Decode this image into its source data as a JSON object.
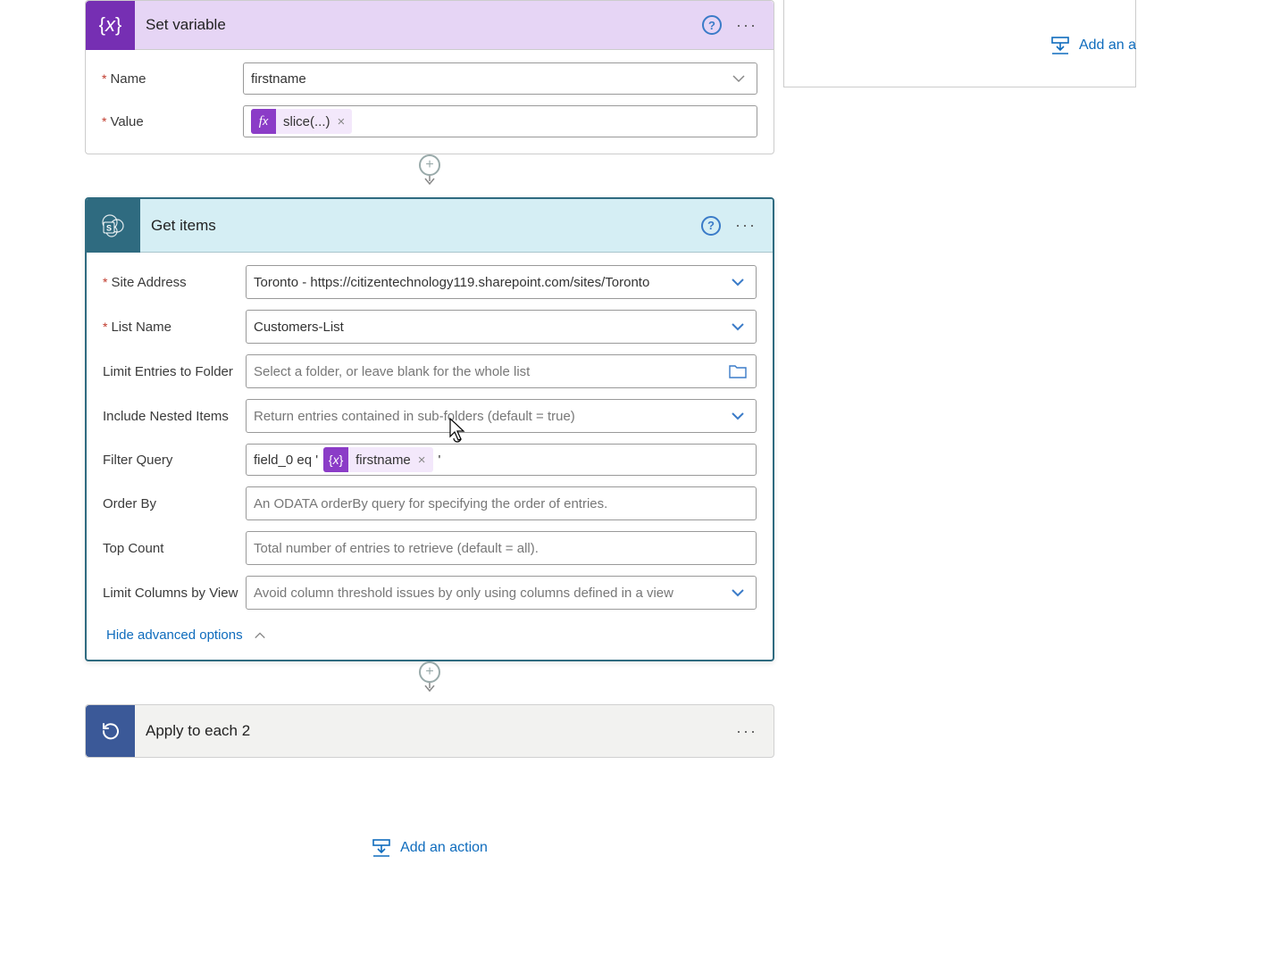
{
  "setvar": {
    "title": "Set variable",
    "name_label": "Name",
    "name_value": "firstname",
    "value_label": "Value",
    "value_token": "slice(...)"
  },
  "getitems": {
    "title": "Get items",
    "site_label": "Site Address",
    "site_value": "Toronto - https://citizentechnology119.sharepoint.com/sites/Toronto",
    "list_label": "List Name",
    "list_value": "Customers-List",
    "folder_label": "Limit Entries to Folder",
    "folder_placeholder": "Select a folder, or leave blank for the whole list",
    "nested_label": "Include Nested Items",
    "nested_placeholder": "Return entries contained in sub-folders (default = true)",
    "filter_label": "Filter Query",
    "filter_prefix": "field_0 eq '",
    "filter_token": "firstname",
    "filter_suffix": "'",
    "orderby_label": "Order By",
    "orderby_placeholder": "An ODATA orderBy query for specifying the order of entries.",
    "top_label": "Top Count",
    "top_placeholder": "Total number of entries to retrieve (default = all).",
    "limitcols_label": "Limit Columns by View",
    "limitcols_placeholder": "Avoid column threshold issues by only using columns defined in a view",
    "hide_adv": "Hide advanced options"
  },
  "apply": {
    "title": "Apply to each 2"
  },
  "add_action_label": "Add an action",
  "right_add_label": "Add an a"
}
